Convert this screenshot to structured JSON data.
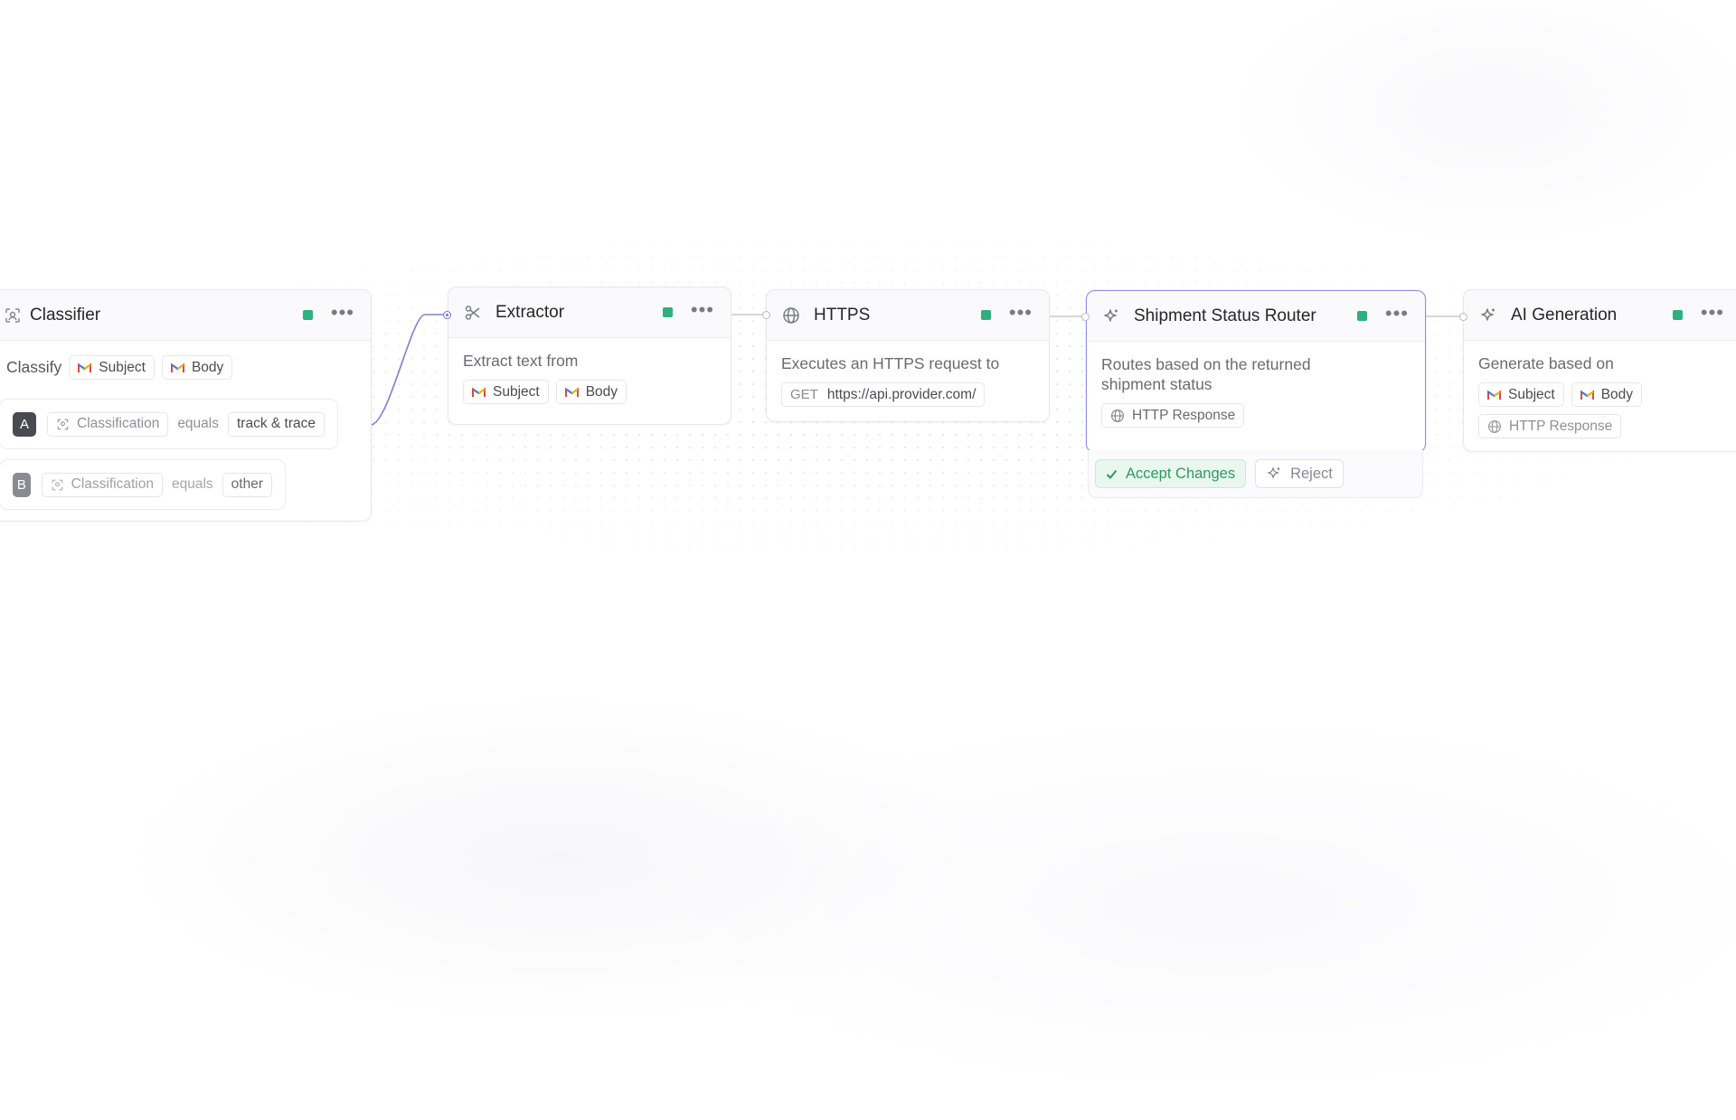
{
  "colors": {
    "status_ok": "#2fb07f",
    "selection": "#8a8ee8",
    "edge_active": "#6c6fd9",
    "accept_text": "#2f9a5e"
  },
  "nodes": {
    "classifier": {
      "title": "Classifier",
      "icon": "classifier-icon",
      "classify_label": "Classify",
      "inputs": [
        "Subject",
        "Body"
      ],
      "rules": [
        {
          "badge": "A",
          "field": "Classification",
          "operator": "equals",
          "value": "track & trace"
        },
        {
          "badge": "B",
          "field": "Classification",
          "operator": "equals",
          "value": "other"
        }
      ]
    },
    "extractor": {
      "title": "Extractor",
      "icon": "scissors-icon",
      "description": "Extract text from",
      "inputs": [
        "Subject",
        "Body"
      ]
    },
    "https": {
      "title": "HTTPS",
      "icon": "globe-icon",
      "description": "Executes an HTTPS request to",
      "method": "GET",
      "url": "https://api.provider.com/"
    },
    "router": {
      "title": "Shipment Status Router",
      "icon": "sparkle-icon",
      "description": "Routes based on the returned shipment status",
      "inputs": [
        "HTTP Response"
      ],
      "accept_label": "Accept Changes",
      "reject_label": "Reject"
    },
    "ai_generation": {
      "title": "AI Generation",
      "icon": "sparkle-icon",
      "description": "Generate based on",
      "inputs": [
        "Subject",
        "Body",
        "HTTP Response"
      ]
    }
  }
}
